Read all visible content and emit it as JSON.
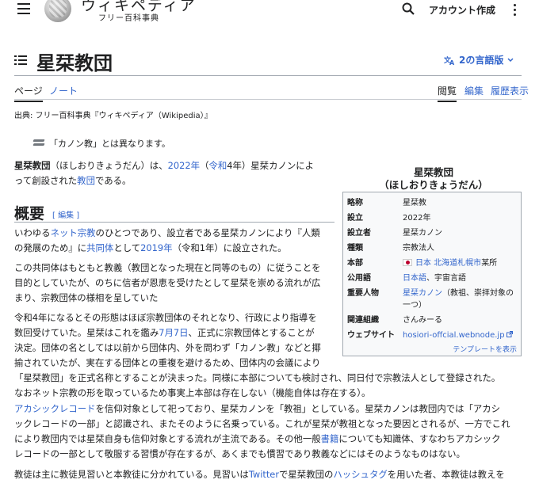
{
  "header": {
    "logo_title": "ウィキペディア",
    "logo_tagline": "フリー百科事典",
    "account": "アカウント作成"
  },
  "title": {
    "text": "星栞教団",
    "languages": "2の言語版"
  },
  "tabs": {
    "page": "ページ",
    "note": "ノート",
    "read": "閲覧",
    "edit": "編集",
    "history": "履歴表示"
  },
  "from": "出典: フリー百科事典『ウィキペディア（Wikipedia）』",
  "hatnote": "「カノン教」とは異なります。",
  "lead": {
    "l1_a": "星栞教団",
    "l1_b": "（ほしおりきょうだん）は、",
    "l1_year": "2022年",
    "l1_c": "（",
    "l1_era": "令和",
    "l1_d": "4年）星栞カノンによ",
    "l2_a": "って創設された",
    "l2_link": "教団",
    "l2_b": "である。"
  },
  "section": {
    "heading": "概要",
    "edit": "[ 編集 ]"
  },
  "p1": {
    "l1_a": "いわゆる",
    "l1_link": "ネット宗教",
    "l1_b": "のひとつであり、設立者である星栞カノンにより『人類",
    "l2_a": "の発展のため』に",
    "l2_link1": "共同体",
    "l2_b": "として",
    "l2_link2": "2019年",
    "l2_c": "（令和1年）に設立された。"
  },
  "p2": {
    "l1": "この共同体はもともと教義（教団となった現在と同等のもの）に従うことを",
    "l2": "目的としていたが、のちに信者が恩恵を受けたとして星栞を崇める流れが広",
    "l3": "まり、宗教団体の様相を呈していた"
  },
  "p3": {
    "l1": "令和4年になるとその形態はほぼ宗教団体のそれとなり、行政により指導を",
    "l2_a": "数回受けていた。星栞はこれを鑑み",
    "l2_link": "7月7日",
    "l2_b": "、正式に宗教団体とすることが",
    "l3": "決定。団体の名としては以前から団体内、外を問わず「カノン教」などと揶",
    "l4": "揄されていたが、実在する団体との重複を避けるため、団体内の会議により",
    "l5": "「星栞教団」を正式名称とすることが決まった。同様に本部についても検討され、同日付で宗教法人として登録された。",
    "l6": "なおネット宗教の形を取っているため事実上本部は存在しない（機能自体は存在する）。"
  },
  "p4": {
    "l1_link": "アカシックレコード",
    "l1_b": "を信仰対象として祀っており、星栞カノンを「教祖」としている。星栞カノンは教団内では「アカシ",
    "l2": "ックレコードの一部」と認識され、またそのように名乗っている。これが星栞が教祖となった要因とされるが、一方でこれ",
    "l3_a": "により教団内では星栞自身も信仰対象とする流れが主流である。その他一般",
    "l3_link": "書籍",
    "l3_b": "についても知識体、すなわちアカシック",
    "l4": "レコードの一部として敬服する習慣が存在するが、あくまでも慣習であり教義などにはそのようなものはない。"
  },
  "p5": {
    "l1_a": "教徒は主に教徒見習いと本教徒に分かれている。見習いは",
    "l1_link1": "Twitter",
    "l1_b": "で星栞教団の",
    "l1_link2": "ハッシュタグ",
    "l1_c": "を用いた者、本教徒は教えを"
  },
  "infobox": {
    "title_l1": "星栞教団",
    "title_l2": "（ほしおりきょうだん）",
    "rows": [
      {
        "label": "略称",
        "value": "星栞教"
      },
      {
        "label": "設立",
        "value": "2022年"
      },
      {
        "label": "設立者",
        "value": "星栞カノン"
      },
      {
        "label": "種類",
        "value": "宗教法人"
      },
      {
        "label": "本部",
        "value_link1": "日本",
        "value_link2": "北海道札幌市",
        "value_rest": "某所"
      },
      {
        "label": "公用語",
        "value_link": "日本語",
        "value_rest": "、宇宙言語"
      },
      {
        "label": "重要人物",
        "value_link": "星栞カノン",
        "value_rest_l1": "（教祖、崇拝対象の",
        "value_rest_l2": "一つ）"
      },
      {
        "label": "関連組織",
        "value": "さんみーる"
      },
      {
        "label": "ウェブサイト",
        "value": "hosiori-offcial.webnode.jp"
      }
    ],
    "template": "テンプレートを表示"
  },
  "colors": {
    "link": "#3366cc",
    "text": "#202122",
    "border": "#a2a9b1"
  }
}
